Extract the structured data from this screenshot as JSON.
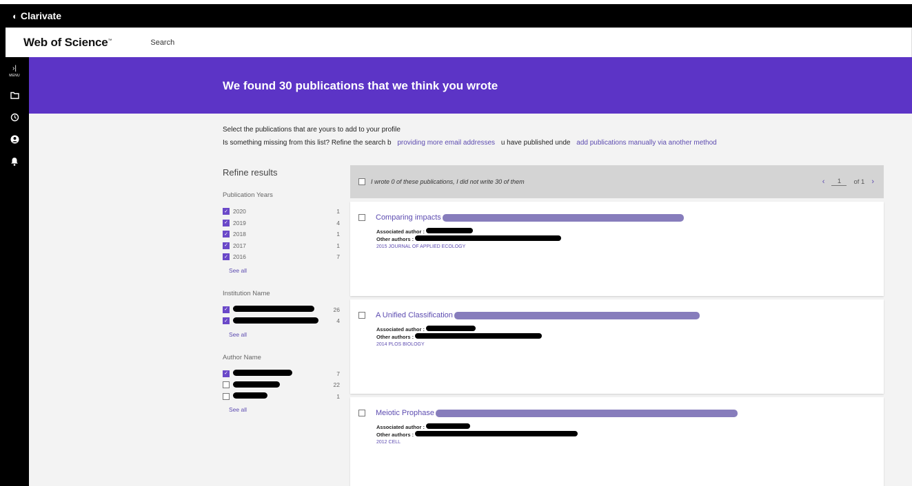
{
  "topbar": {
    "brand": "Clarivate",
    "brand_icon": "clarivate-logo-icon"
  },
  "header": {
    "product": "Web of Science",
    "trademark": "™",
    "nav_search": "Search"
  },
  "sidenav": {
    "menu_label": "MENU",
    "icons": [
      "expand-menu-icon",
      "folder-icon",
      "history-icon",
      "user-icon",
      "bell-icon"
    ]
  },
  "banner": {
    "title": "We found 30 publications that we think you wrote"
  },
  "intro": {
    "line1": "Select the publications that are yours to add to your profile",
    "line2_prefix": "Is something missing from this list? Refine the search b",
    "link_emails": "providing more email addresses",
    "line2_mid": "u have published unde",
    "link_manual": "add publications manually via another method"
  },
  "refine": {
    "title": "Refine results",
    "facets": [
      {
        "title": "Publication Years",
        "rows": [
          {
            "label": "2020",
            "count": "1",
            "checked": true
          },
          {
            "label": "2019",
            "count": "4",
            "checked": true
          },
          {
            "label": "2018",
            "count": "1",
            "checked": true
          },
          {
            "label": "2017",
            "count": "1",
            "checked": true
          },
          {
            "label": "2016",
            "count": "7",
            "checked": true
          }
        ],
        "see_all": "See all"
      },
      {
        "title": "Institution Name",
        "rows": [
          {
            "label": "",
            "count": "26",
            "checked": true
          },
          {
            "label": "",
            "count": "4",
            "checked": true
          }
        ],
        "see_all": "See all"
      },
      {
        "title": "Author Name",
        "rows": [
          {
            "label": "",
            "count": "7",
            "checked": true
          },
          {
            "label": "",
            "count": "22",
            "checked": false
          },
          {
            "label": "",
            "count": "1",
            "checked": false
          }
        ],
        "see_all": "See all"
      }
    ]
  },
  "results": {
    "summary": "I wrote 0 of these publications, I did not write 30 of them",
    "pager": {
      "prev": "‹",
      "current": "1",
      "of": "of 1",
      "next": "›"
    },
    "items": [
      {
        "title": "Comparing impacts",
        "assoc_label": "Associated author :",
        "other_label": "Other authors :",
        "source": "2015 JOURNAL OF APPLIED ECOLOGY"
      },
      {
        "title": "A Unified Classification",
        "assoc_label": "Associated author :",
        "other_label": "Other authors :",
        "source": "2014 PLOS BIOLOGY"
      },
      {
        "title": "Meiotic Prophase",
        "assoc_label": "Associated author :",
        "other_label": "Other authors :",
        "source": "2012 CELL"
      }
    ]
  },
  "colors": {
    "accent": "#5c34c6",
    "link": "#5c4bb0",
    "checkbox": "#6a48c8"
  }
}
